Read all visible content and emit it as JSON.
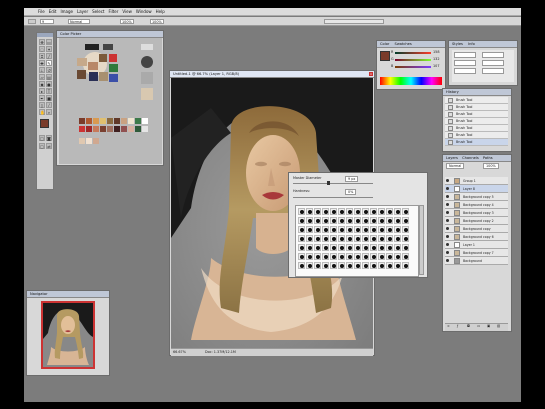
{
  "menu": {
    "items": [
      "File",
      "Edit",
      "Image",
      "Layer",
      "Select",
      "Filter",
      "View",
      "Window",
      "Help"
    ]
  },
  "options": {
    "mode_value": "Normal",
    "opacity_value": "100%",
    "flow_value": "100%",
    "brush_size": "9"
  },
  "document": {
    "title": "Untitled-1 @ 66.7% (Layer 1, RGB/8)",
    "zoom": "66.67%",
    "doc_info": "Doc: 1.37M/12.1M"
  },
  "color_picker": {
    "title": "Color Picker"
  },
  "navigator": {
    "title": "Navigator"
  },
  "color_panel": {
    "tabs": [
      "Color",
      "Swatches"
    ],
    "r": "R",
    "g": "G",
    "b": "B",
    "r_val": "158",
    "g_val": "132",
    "b_val": "107"
  },
  "styles_panel": {
    "tabs": [
      "Styles",
      "Info"
    ]
  },
  "history": {
    "title": "History",
    "items": [
      "Brush Tool",
      "Brush Tool",
      "Brush Tool",
      "Brush Tool",
      "Brush Tool",
      "Brush Tool",
      "Brush Tool"
    ]
  },
  "brush_picker": {
    "diameter_label": "Master Diameter",
    "diameter_value": "9 px",
    "hardness_label": "Hardness:",
    "hardness_value": "0%"
  },
  "layers": {
    "tabs": [
      "Layers",
      "Channels",
      "Paths"
    ],
    "blend": "Normal",
    "opacity": "100%",
    "items": [
      "Group 1",
      "Layer 8",
      "Background copy 5",
      "Background copy 4",
      "Background copy 3",
      "Background copy 2",
      "Background copy",
      "Background copy 6",
      "Layer 1",
      "Background copy 7",
      "Background"
    ]
  },
  "colors": {
    "foreground": "#7a3b2a",
    "background": "#ffffff",
    "accent_title": "#bfc7d6"
  }
}
